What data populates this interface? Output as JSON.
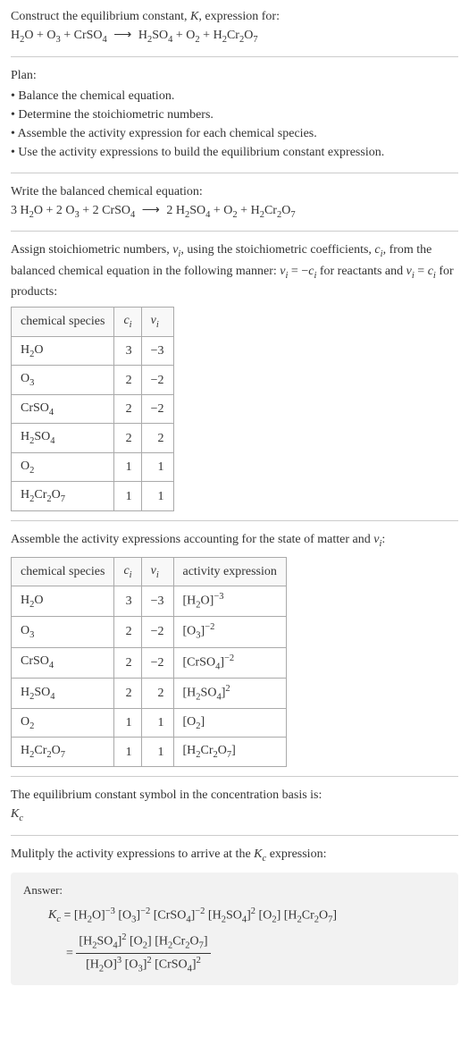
{
  "header": {
    "prompt": "Construct the equilibrium constant, K, expression for:",
    "equation": "H₂O + O₃ + CrSO₄ ⟶ H₂SO₄ + O₂ + H₂Cr₂O₇"
  },
  "plan": {
    "title": "Plan:",
    "items": [
      "• Balance the chemical equation.",
      "• Determine the stoichiometric numbers.",
      "• Assemble the activity expression for each chemical species.",
      "• Use the activity expressions to build the equilibrium constant expression."
    ]
  },
  "balanced": {
    "intro": "Write the balanced chemical equation:",
    "equation": "3 H₂O + 2 O₃ + 2 CrSO₄ ⟶ 2 H₂SO₄ + O₂ + H₂Cr₂O₇"
  },
  "stoich": {
    "intro": "Assign stoichiometric numbers, νᵢ, using the stoichiometric coefficients, cᵢ, from the balanced chemical equation in the following manner: νᵢ = −cᵢ for reactants and νᵢ = cᵢ for products:",
    "headers": [
      "chemical species",
      "cᵢ",
      "νᵢ"
    ],
    "rows": [
      {
        "species": "H₂O",
        "c": "3",
        "v": "−3"
      },
      {
        "species": "O₃",
        "c": "2",
        "v": "−2"
      },
      {
        "species": "CrSO₄",
        "c": "2",
        "v": "−2"
      },
      {
        "species": "H₂SO₄",
        "c": "2",
        "v": "2"
      },
      {
        "species": "O₂",
        "c": "1",
        "v": "1"
      },
      {
        "species": "H₂Cr₂O₇",
        "c": "1",
        "v": "1"
      }
    ]
  },
  "activity": {
    "intro": "Assemble the activity expressions accounting for the state of matter and νᵢ:",
    "headers": [
      "chemical species",
      "cᵢ",
      "νᵢ",
      "activity expression"
    ],
    "rows": [
      {
        "species": "H₂O",
        "c": "3",
        "v": "−3",
        "expr": "[H₂O]⁻³"
      },
      {
        "species": "O₃",
        "c": "2",
        "v": "−2",
        "expr": "[O₃]⁻²"
      },
      {
        "species": "CrSO₄",
        "c": "2",
        "v": "−2",
        "expr": "[CrSO₄]⁻²"
      },
      {
        "species": "H₂SO₄",
        "c": "2",
        "v": "2",
        "expr": "[H₂SO₄]²"
      },
      {
        "species": "O₂",
        "c": "1",
        "v": "1",
        "expr": "[O₂]"
      },
      {
        "species": "H₂Cr₂O₇",
        "c": "1",
        "v": "1",
        "expr": "[H₂Cr₂O₇]"
      }
    ]
  },
  "symbol": {
    "intro": "The equilibrium constant symbol in the concentration basis is:",
    "value": "K꜀"
  },
  "multiply": {
    "intro": "Mulitply the activity expressions to arrive at the K꜀ expression:"
  },
  "answer": {
    "label": "Answer:",
    "line1_lhs": "K꜀ = ",
    "line1_rhs": "[H₂O]⁻³ [O₃]⁻² [CrSO₄]⁻² [H₂SO₄]² [O₂] [H₂Cr₂O₇]",
    "line2_eq": "= ",
    "frac_num": "[H₂SO₄]² [O₂] [H₂Cr₂O₇]",
    "frac_den": "[H₂O]³ [O₃]² [CrSO₄]²"
  }
}
